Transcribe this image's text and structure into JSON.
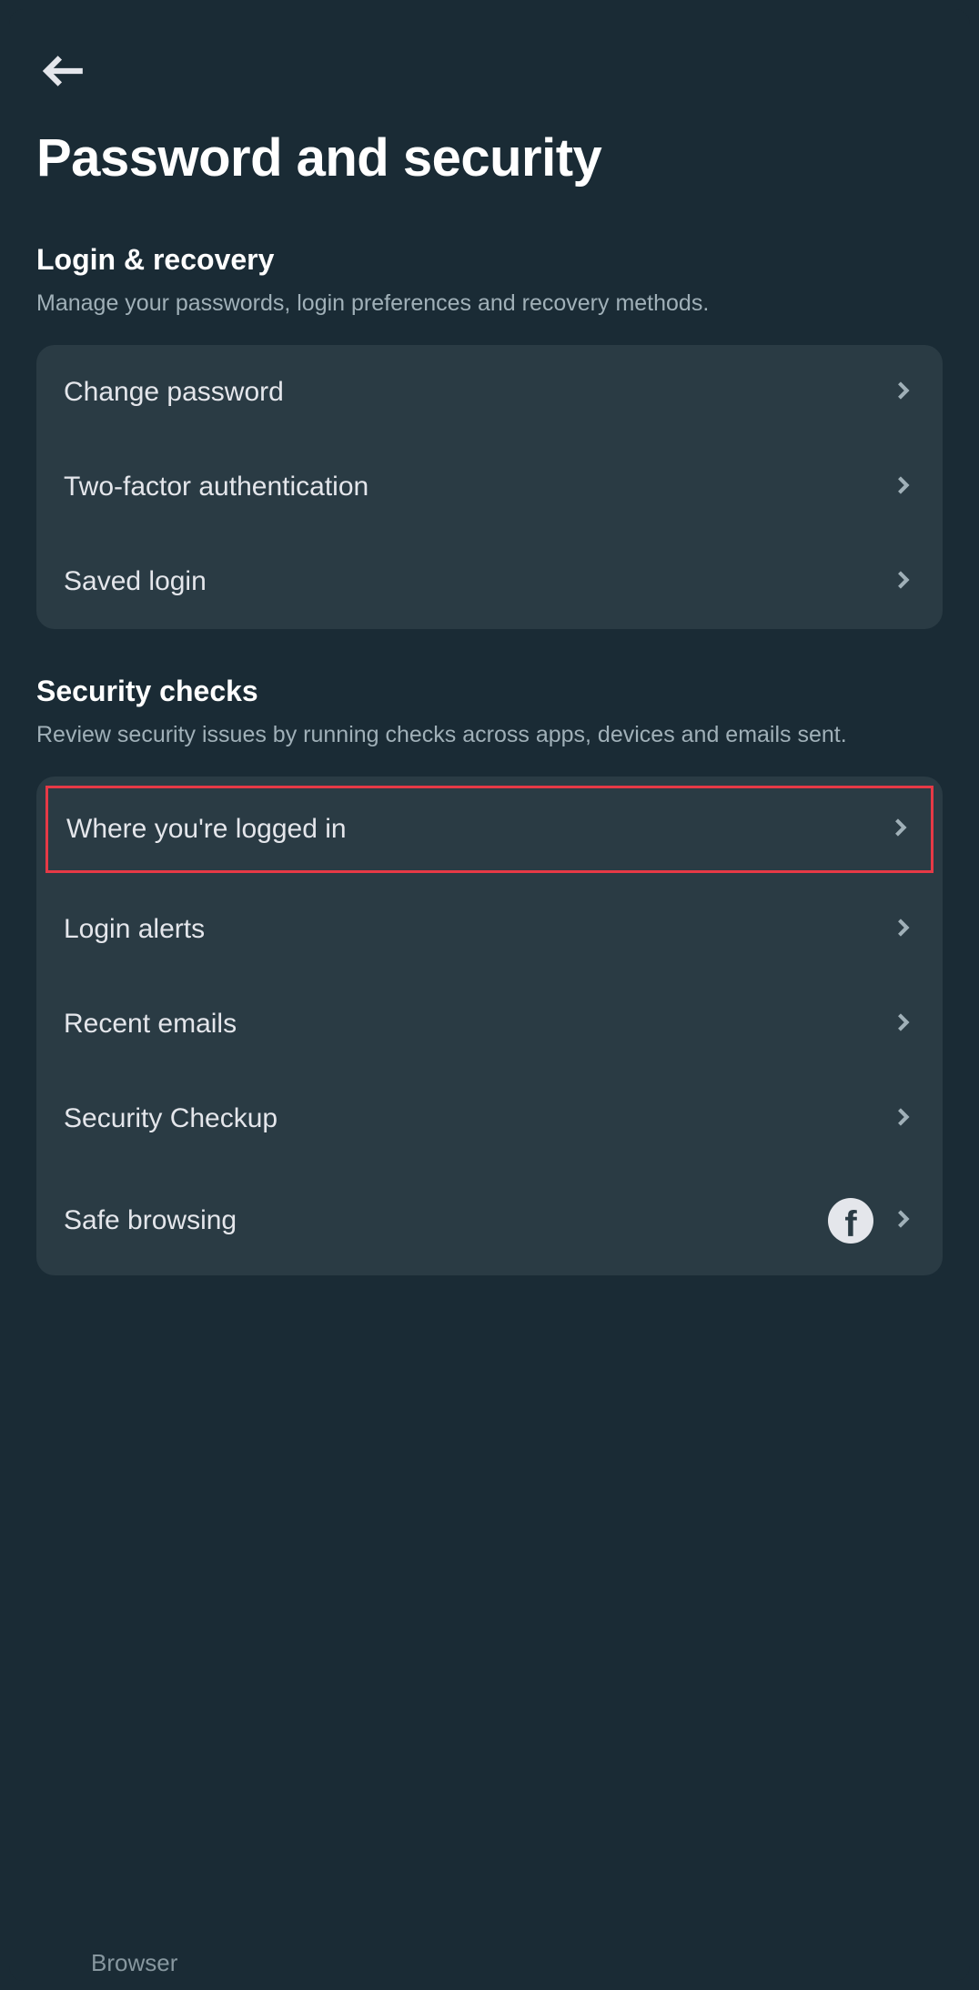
{
  "header": {
    "title": "Password and security"
  },
  "sections": {
    "login_recovery": {
      "title": "Login & recovery",
      "desc": "Manage your passwords, login preferences and recovery methods.",
      "items": [
        {
          "label": "Change password"
        },
        {
          "label": "Two-factor authentication"
        },
        {
          "label": "Saved login"
        }
      ]
    },
    "security_checks": {
      "title": "Security checks",
      "desc": "Review security issues by running checks across apps, devices and emails sent.",
      "items": [
        {
          "label": "Where you're logged in",
          "highlighted": true
        },
        {
          "label": "Login alerts"
        },
        {
          "label": "Recent emails"
        },
        {
          "label": "Security Checkup"
        },
        {
          "label": "Safe browsing",
          "icon": "facebook"
        }
      ]
    }
  },
  "bottom_hint": "Browser"
}
